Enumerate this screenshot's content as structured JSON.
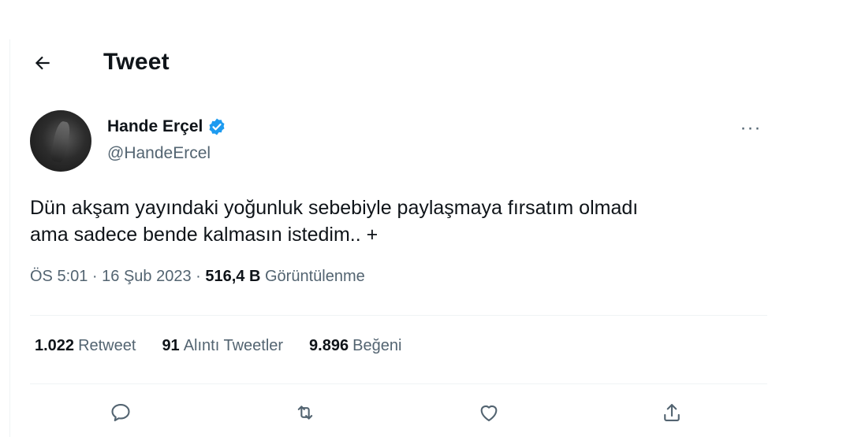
{
  "header": {
    "title": "Tweet"
  },
  "author": {
    "name": "Hande Erçel",
    "handle": "@HandeErcel"
  },
  "tweet": {
    "line1": "Dün akşam yayındaki yoğunluk sebebiyle paylaşmaya fırsatım olmadı",
    "line2": "ama sadece bende kalmasın istedim.. +",
    "time": "ÖS 5:01 · 16 Şub 2023 · ",
    "views_count": "516,4 B",
    "views_label": " Görüntülenme"
  },
  "stats": {
    "retweets_count": "1.022",
    "retweets_label": "Retweet",
    "quotes_count": "91",
    "quotes_label": "Alıntı Tweetler",
    "likes_count": "9.896",
    "likes_label": "Beğeni"
  },
  "more_menu": "···",
  "icons": {
    "back": "arrow-left-icon",
    "verified": "verified-badge-icon",
    "reply": "reply-icon",
    "retweet": "retweet-icon",
    "like": "heart-icon",
    "share": "share-icon"
  },
  "colors": {
    "verified_blue": "#1d9bf0",
    "secondary_text": "#536471",
    "primary_text": "#0f1419"
  }
}
